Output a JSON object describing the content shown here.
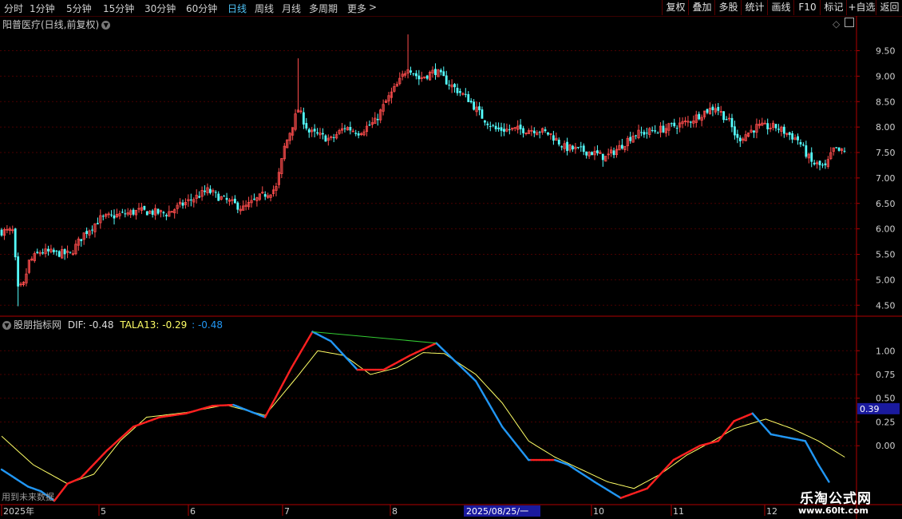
{
  "toolbar": {
    "periods": [
      "分时",
      "1分钟",
      "5分钟",
      "15分钟",
      "30分钟",
      "60分钟",
      "日线",
      "周线",
      "月线",
      "多周期",
      "更多"
    ],
    "active_period": "日线",
    "buttons": [
      "复权",
      "叠加",
      "多股",
      "统计",
      "画线",
      "F10",
      "标记",
      "+自选",
      "返回"
    ]
  },
  "main_panel": {
    "stock_title": "阳普医疗(日线,前复权)"
  },
  "indicator_panel": {
    "name": "股朋指标网",
    "dif_label": "DIF: -0.48",
    "tala_label": "TALA13: -0.29",
    "third_label": ": -0.48",
    "current_value_tag": "0.39",
    "future_note": "用到未来数据"
  },
  "x_axis": {
    "labels": [
      "2025年",
      "5",
      "6",
      "7",
      "8",
      "10",
      "11",
      "12"
    ],
    "cursor_label": "2025/08/25/一"
  },
  "watermark": {
    "line1": "乐淘公式网",
    "line2": "www.60lt.com"
  },
  "colors": {
    "up": "#ff4d4d",
    "down": "#54ffff",
    "dif_up": "#ff2020",
    "dif_down": "#2196f3",
    "tala": "#ffff66",
    "peak_line": "#33cc33",
    "axis": "#b00000",
    "grid": "#4a0000"
  },
  "chart_data": [
    {
      "type": "candlestick",
      "title": "阳普医疗(日线,前复权)",
      "y_ticks": [
        9.5,
        9.0,
        8.5,
        8.0,
        7.5,
        7.0,
        6.5,
        6.0,
        5.5,
        5.0,
        4.5
      ],
      "ylim": [
        4.3,
        9.9
      ],
      "keypoints": [
        [
          0,
          5.95
        ],
        [
          4,
          5.95
        ],
        [
          6,
          4.8
        ],
        [
          8,
          4.9
        ],
        [
          10,
          5.35
        ],
        [
          14,
          5.55
        ],
        [
          25,
          5.5
        ],
        [
          30,
          5.9
        ],
        [
          36,
          6.2
        ],
        [
          50,
          6.35
        ],
        [
          60,
          6.3
        ],
        [
          75,
          6.75
        ],
        [
          80,
          6.6
        ],
        [
          88,
          6.4
        ],
        [
          95,
          6.65
        ],
        [
          100,
          6.8
        ],
        [
          103,
          7.6
        ],
        [
          108,
          8.35
        ],
        [
          112,
          7.9
        ],
        [
          120,
          7.75
        ],
        [
          125,
          8.0
        ],
        [
          130,
          7.9
        ],
        [
          136,
          8.1
        ],
        [
          140,
          8.5
        ],
        [
          145,
          8.9
        ],
        [
          148,
          9.2
        ],
        [
          152,
          8.95
        ],
        [
          158,
          9.1
        ],
        [
          163,
          8.85
        ],
        [
          170,
          8.55
        ],
        [
          175,
          8.2
        ],
        [
          180,
          7.95
        ],
        [
          195,
          7.95
        ],
        [
          200,
          7.85
        ],
        [
          205,
          7.6
        ],
        [
          215,
          7.5
        ],
        [
          220,
          7.4
        ],
        [
          225,
          7.6
        ],
        [
          230,
          7.85
        ],
        [
          240,
          7.95
        ],
        [
          250,
          8.1
        ],
        [
          256,
          8.3
        ],
        [
          260,
          8.4
        ],
        [
          265,
          8.1
        ],
        [
          268,
          7.75
        ],
        [
          275,
          8.0
        ],
        [
          282,
          8.0
        ],
        [
          290,
          7.75
        ],
        [
          295,
          7.3
        ],
        [
          300,
          7.2
        ],
        [
          303,
          7.55
        ],
        [
          307,
          7.5
        ]
      ]
    },
    {
      "type": "line",
      "title": "股朋指标网",
      "y_ticks": [
        1.0,
        0.75,
        0.5,
        0.25,
        0.0
      ],
      "ylim": [
        -0.62,
        1.33
      ],
      "series": [
        {
          "name": "DIF",
          "keypoints": [
            [
              0,
              -0.25
            ],
            [
              10,
              -0.43
            ],
            [
              15,
              -0.48
            ],
            [
              20,
              -0.58
            ],
            [
              25,
              -0.4
            ],
            [
              30,
              -0.34
            ],
            [
              40,
              -0.05
            ],
            [
              50,
              0.2
            ],
            [
              60,
              0.3
            ],
            [
              70,
              0.34
            ],
            [
              80,
              0.42
            ],
            [
              88,
              0.43
            ],
            [
              100,
              0.3
            ],
            [
              110,
              0.82
            ],
            [
              118,
              1.2
            ],
            [
              125,
              1.1
            ],
            [
              135,
              0.8
            ],
            [
              145,
              0.8
            ],
            [
              155,
              0.95
            ],
            [
              165,
              1.08
            ],
            [
              180,
              0.68
            ],
            [
              190,
              0.2
            ],
            [
              200,
              -0.15
            ],
            [
              210,
              -0.15
            ],
            [
              215,
              -0.2
            ],
            [
              225,
              -0.38
            ],
            [
              235,
              -0.55
            ],
            [
              245,
              -0.45
            ],
            [
              255,
              -0.15
            ],
            [
              265,
              0.0
            ],
            [
              272,
              0.05
            ],
            [
              278,
              0.26
            ],
            [
              285,
              0.34
            ],
            [
              292,
              0.12
            ],
            [
              305,
              0.05
            ],
            [
              310,
              -0.2
            ],
            [
              314,
              -0.38
            ]
          ]
        },
        {
          "name": "TALA13",
          "keypoints": [
            [
              0,
              0.1
            ],
            [
              12,
              -0.2
            ],
            [
              25,
              -0.4
            ],
            [
              35,
              -0.3
            ],
            [
              45,
              0.05
            ],
            [
              55,
              0.3
            ],
            [
              70,
              0.35
            ],
            [
              85,
              0.43
            ],
            [
              100,
              0.32
            ],
            [
              112,
              0.72
            ],
            [
              120,
              1.0
            ],
            [
              130,
              0.95
            ],
            [
              140,
              0.75
            ],
            [
              150,
              0.82
            ],
            [
              160,
              0.98
            ],
            [
              168,
              0.97
            ],
            [
              180,
              0.75
            ],
            [
              190,
              0.45
            ],
            [
              200,
              0.05
            ],
            [
              210,
              -0.12
            ],
            [
              220,
              -0.25
            ],
            [
              230,
              -0.38
            ],
            [
              240,
              -0.45
            ],
            [
              250,
              -0.3
            ],
            [
              260,
              -0.1
            ],
            [
              270,
              0.05
            ],
            [
              278,
              0.18
            ],
            [
              290,
              0.28
            ],
            [
              300,
              0.18
            ],
            [
              310,
              0.05
            ],
            [
              320,
              -0.12
            ]
          ]
        }
      ]
    }
  ]
}
